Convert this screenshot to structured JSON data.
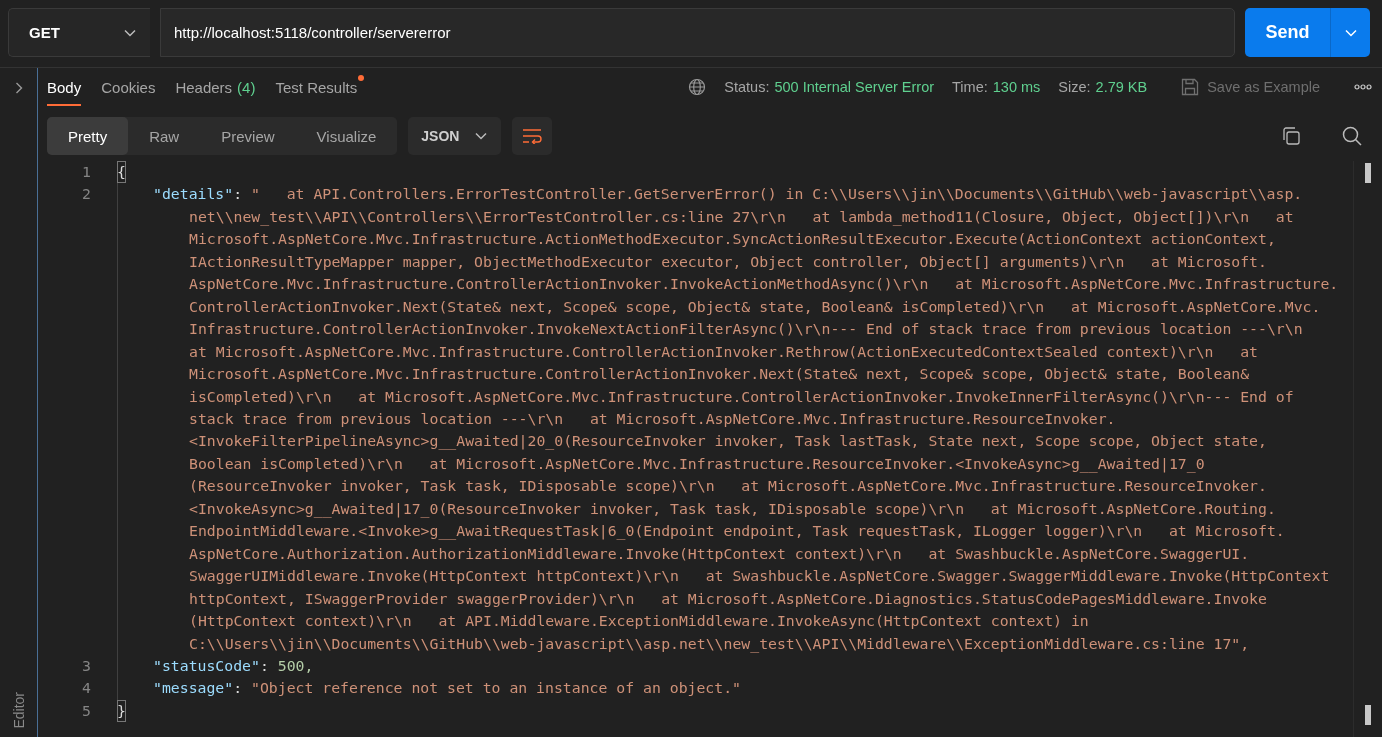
{
  "request": {
    "method": "GET",
    "url": "http://localhost:5118/controller/servererror",
    "send_label": "Send"
  },
  "side_panel": {
    "label": "Editor"
  },
  "response": {
    "tabs": [
      {
        "label": "Body",
        "selected": true
      },
      {
        "label": "Cookies",
        "selected": false
      },
      {
        "label": "Headers",
        "count": "(4)",
        "selected": false
      },
      {
        "label": "Test Results",
        "dot": true,
        "selected": false
      }
    ],
    "meta": [
      {
        "label": "Status:",
        "value": "500 Internal Server Error"
      },
      {
        "label": "Time:",
        "value": "130 ms"
      },
      {
        "label": "Size:",
        "value": "2.79 KB"
      }
    ],
    "save_button": {
      "label": "Save as Example",
      "disabled": true
    }
  },
  "body_toolbar": {
    "views": [
      {
        "label": "Pretty",
        "selected": true
      },
      {
        "label": "Raw",
        "selected": false
      },
      {
        "label": "Preview",
        "selected": false
      },
      {
        "label": "Visualize",
        "selected": false
      }
    ],
    "format": "JSON"
  },
  "code": {
    "lines": [
      {
        "number": "1",
        "kind": "brace",
        "text": "{"
      },
      {
        "number": "2",
        "kind": "string_pair",
        "key": "\"details\"",
        "separator": ":",
        "value_lines": [
          "\"   at API.Controllers.ErrorTestController.GetServerError() in C:\\\\Users\\\\jin\\\\Documents\\\\GitHub\\\\web-javascript\\\\asp.",
          "net\\\\new_test\\\\API\\\\Controllers\\\\ErrorTestController.cs:line 27\\r\\n   at lambda_method11(Closure, Object, Object[])\\r\\n   at",
          "Microsoft.AspNetCore.Mvc.Infrastructure.ActionMethodExecutor.SyncActionResultExecutor.Execute(ActionContext actionContext,",
          "IActionResultTypeMapper mapper, ObjectMethodExecutor executor, Object controller, Object[] arguments)\\r\\n   at Microsoft.",
          "AspNetCore.Mvc.Infrastructure.ControllerActionInvoker.InvokeActionMethodAsync()\\r\\n   at Microsoft.AspNetCore.Mvc.Infrastructure.",
          "ControllerActionInvoker.Next(State& next, Scope& scope, Object& state, Boolean& isCompleted)\\r\\n   at Microsoft.AspNetCore.Mvc.",
          "Infrastructure.ControllerActionInvoker.InvokeNextActionFilterAsync()\\r\\n--- End of stack trace from previous location ---\\r\\n",
          "at Microsoft.AspNetCore.Mvc.Infrastructure.ControllerActionInvoker.Rethrow(ActionExecutedContextSealed context)\\r\\n   at",
          "Microsoft.AspNetCore.Mvc.Infrastructure.ControllerActionInvoker.Next(State& next, Scope& scope, Object& state, Boolean&",
          "isCompleted)\\r\\n   at Microsoft.AspNetCore.Mvc.Infrastructure.ControllerActionInvoker.InvokeInnerFilterAsync()\\r\\n--- End of",
          "stack trace from previous location ---\\r\\n   at Microsoft.AspNetCore.Mvc.Infrastructure.ResourceInvoker.",
          "<InvokeFilterPipelineAsync>g__Awaited|20_0(ResourceInvoker invoker, Task lastTask, State next, Scope scope, Object state,",
          "Boolean isCompleted)\\r\\n   at Microsoft.AspNetCore.Mvc.Infrastructure.ResourceInvoker.<InvokeAsync>g__Awaited|17_0",
          "(ResourceInvoker invoker, Task task, IDisposable scope)\\r\\n   at Microsoft.AspNetCore.Mvc.Infrastructure.ResourceInvoker.",
          "<InvokeAsync>g__Awaited|17_0(ResourceInvoker invoker, Task task, IDisposable scope)\\r\\n   at Microsoft.AspNetCore.Routing.",
          "EndpointMiddleware.<Invoke>g__AwaitRequestTask|6_0(Endpoint endpoint, Task requestTask, ILogger logger)\\r\\n   at Microsoft.",
          "AspNetCore.Authorization.AuthorizationMiddleware.Invoke(HttpContext context)\\r\\n   at Swashbuckle.AspNetCore.SwaggerUI.",
          "SwaggerUIMiddleware.Invoke(HttpContext httpContext)\\r\\n   at Swashbuckle.AspNetCore.Swagger.SwaggerMiddleware.Invoke(HttpContext",
          "httpContext, ISwaggerProvider swaggerProvider)\\r\\n   at Microsoft.AspNetCore.Diagnostics.StatusCodePagesMiddleware.Invoke",
          "(HttpContext context)\\r\\n   at API.Middleware.ExceptionMiddleware.InvokeAsync(HttpContext context) in",
          "C:\\\\Users\\\\jin\\\\Documents\\\\GitHub\\\\web-javascript\\\\asp.net\\\\new_test\\\\API\\\\Middleware\\\\ExceptionMiddleware.cs:line 17\","
        ]
      },
      {
        "number": "3",
        "kind": "number_pair",
        "key": "\"statusCode\"",
        "separator": ":",
        "value_lines": [
          "500,"
        ]
      },
      {
        "number": "4",
        "kind": "string_pair",
        "key": "\"message\"",
        "separator": ":",
        "value_lines": [
          "\"Object reference not set to an instance of an object.\""
        ]
      },
      {
        "number": "5",
        "kind": "brace",
        "text": "}"
      }
    ]
  }
}
